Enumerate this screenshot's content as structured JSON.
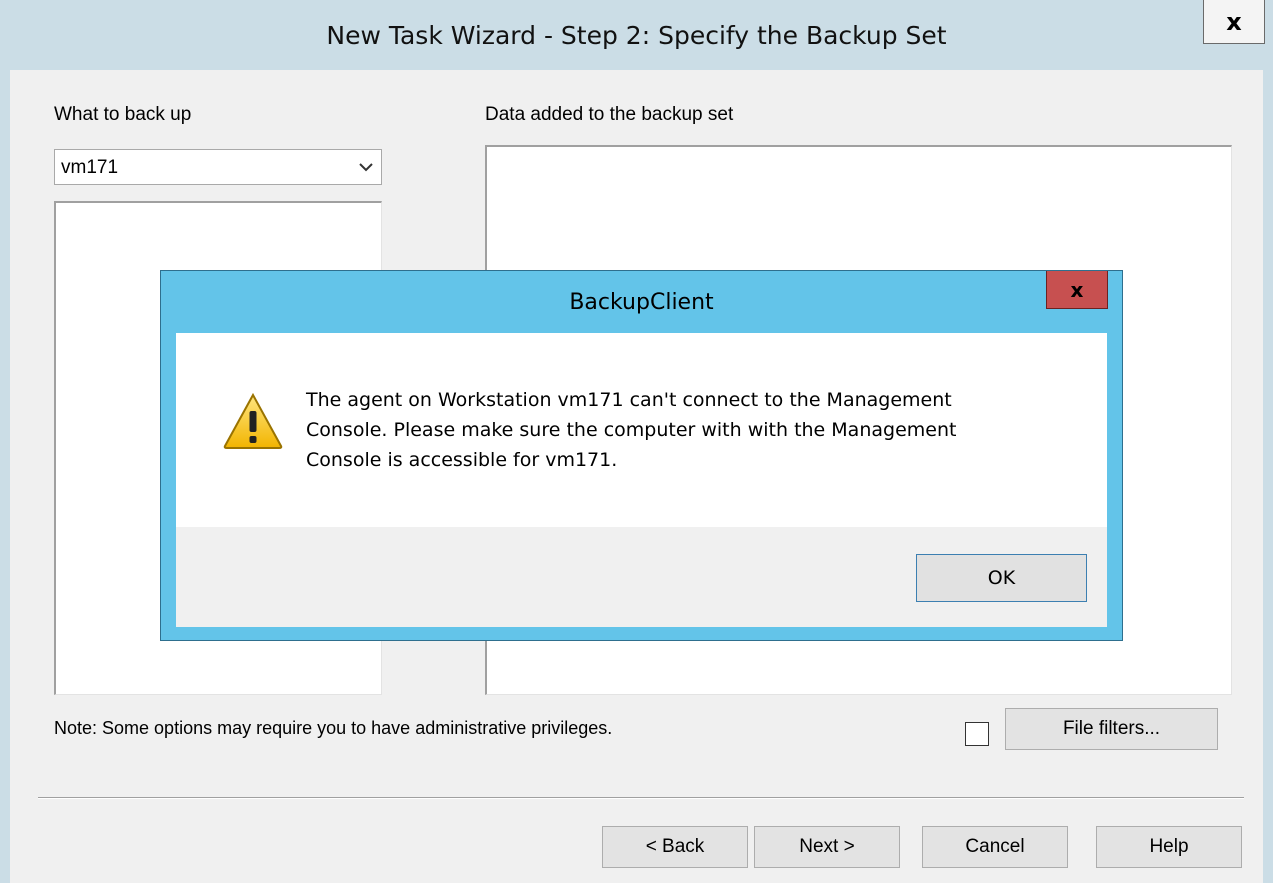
{
  "wizard": {
    "title": "New Task Wizard - Step 2: Specify the Backup Set",
    "close_label": "x",
    "what_to_back_up_label": "What to back up",
    "data_added_label": "Data added to the backup set",
    "source_combo": {
      "selected": "vm171"
    },
    "note": "Note: Some options may require you to have administrative privileges.",
    "file_filters_checked": false,
    "file_filters_label": "File filters...",
    "buttons": {
      "back": "< Back",
      "next": "Next >",
      "cancel": "Cancel",
      "help": "Help"
    }
  },
  "dialog": {
    "title": "BackupClient",
    "close_label": "x",
    "icon": "warning-icon",
    "message": "The agent on Workstation vm171 can't connect to the Management\nConsole. Please make sure the computer with with the Management\nConsole is accessible for vm171.",
    "ok_label": "OK"
  },
  "colors": {
    "dialog_frame": "#63c4e9",
    "dialog_close": "#c75050",
    "window_frame": "#cbdde6",
    "ok_border": "#3c7fb1"
  }
}
